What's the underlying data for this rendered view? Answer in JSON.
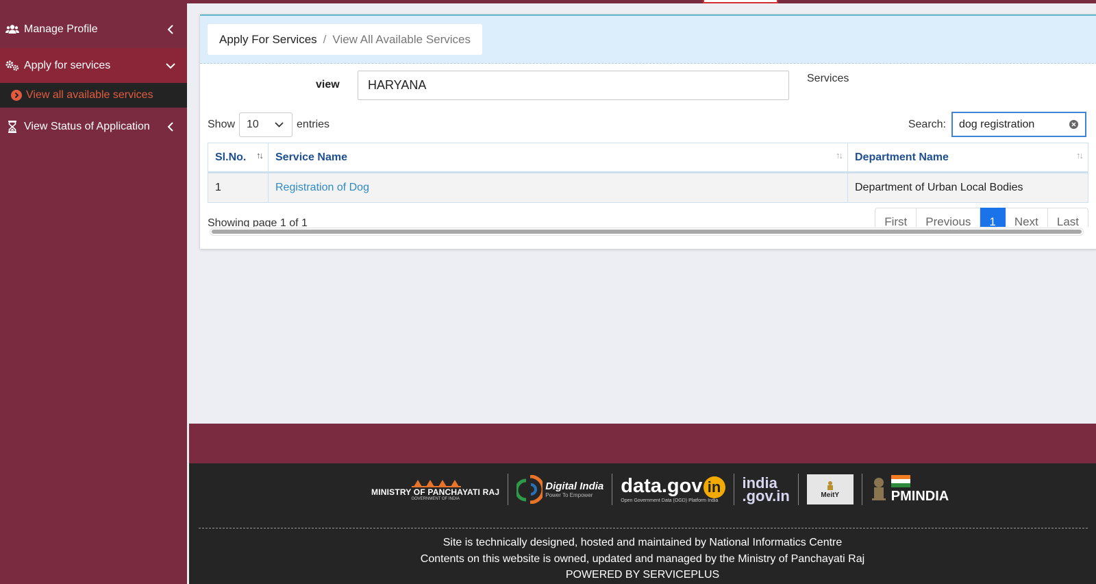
{
  "sidebar": {
    "items": [
      {
        "label": "Manage Profile",
        "icon": "users-icon"
      },
      {
        "label": "Apply for services",
        "icon": "cogs-icon"
      },
      {
        "label": "View all available services",
        "icon": "chevron-circle-right-icon"
      },
      {
        "label": "View Status of Application",
        "icon": "hourglass-icon"
      }
    ]
  },
  "breadcrumb": {
    "parent": "Apply For Services",
    "separator": "/",
    "current": "View All Available Services"
  },
  "filter": {
    "view_label": "view",
    "view_value": "HARYANA",
    "services_label": "Services"
  },
  "table_controls": {
    "show_label": "Show",
    "page_length": "10",
    "entries_label": "entries",
    "search_label": "Search:",
    "search_value": "dog registration"
  },
  "table": {
    "columns": [
      "Sl.No.",
      "Service Name",
      "Department Name"
    ],
    "rows": [
      {
        "sl_no": "1",
        "service_name": "Registration of Dog",
        "department_name": "Department of Urban Local Bodies"
      }
    ]
  },
  "pagination": {
    "info": "Showing page 1 of 1",
    "first": "First",
    "previous": "Previous",
    "current": "1",
    "next": "Next",
    "last": "Last"
  },
  "footer": {
    "logos": {
      "mopr": {
        "title": "MINISTRY OF PANCHAYATI RAJ",
        "sub": "GOVERNMENT OF INDIA"
      },
      "digital_india": {
        "title": "Digital India",
        "sub": "Power To Empower"
      },
      "data_gov": {
        "title": "data.gov",
        "badge": "in",
        "sub": "Open Government Data (OGD) Platform India"
      },
      "india_gov": {
        "line1": "india",
        "line2": ".gov.in"
      },
      "meity": {
        "title": "MeitY"
      },
      "pmindia": {
        "title": "PMINDIA"
      }
    },
    "lines": [
      "Site is technically designed, hosted and maintained by National Informatics Centre",
      "Contents on this website is owned, updated and managed by the Ministry of Panchayati Raj",
      "POWERED BY SERVICEPLUS"
    ]
  },
  "colors": {
    "sidebar_bg": "#7a2b3f",
    "sidebar_active_bg": "#8b2538",
    "sub_item_bg": "#232323",
    "sub_item_text": "#e25b3f",
    "panel_head_bg": "#dceefb",
    "table_header_text": "#1d4f91",
    "link": "#2f8ac5",
    "pager_active": "#1a73e8",
    "footer_bg": "#252525"
  }
}
